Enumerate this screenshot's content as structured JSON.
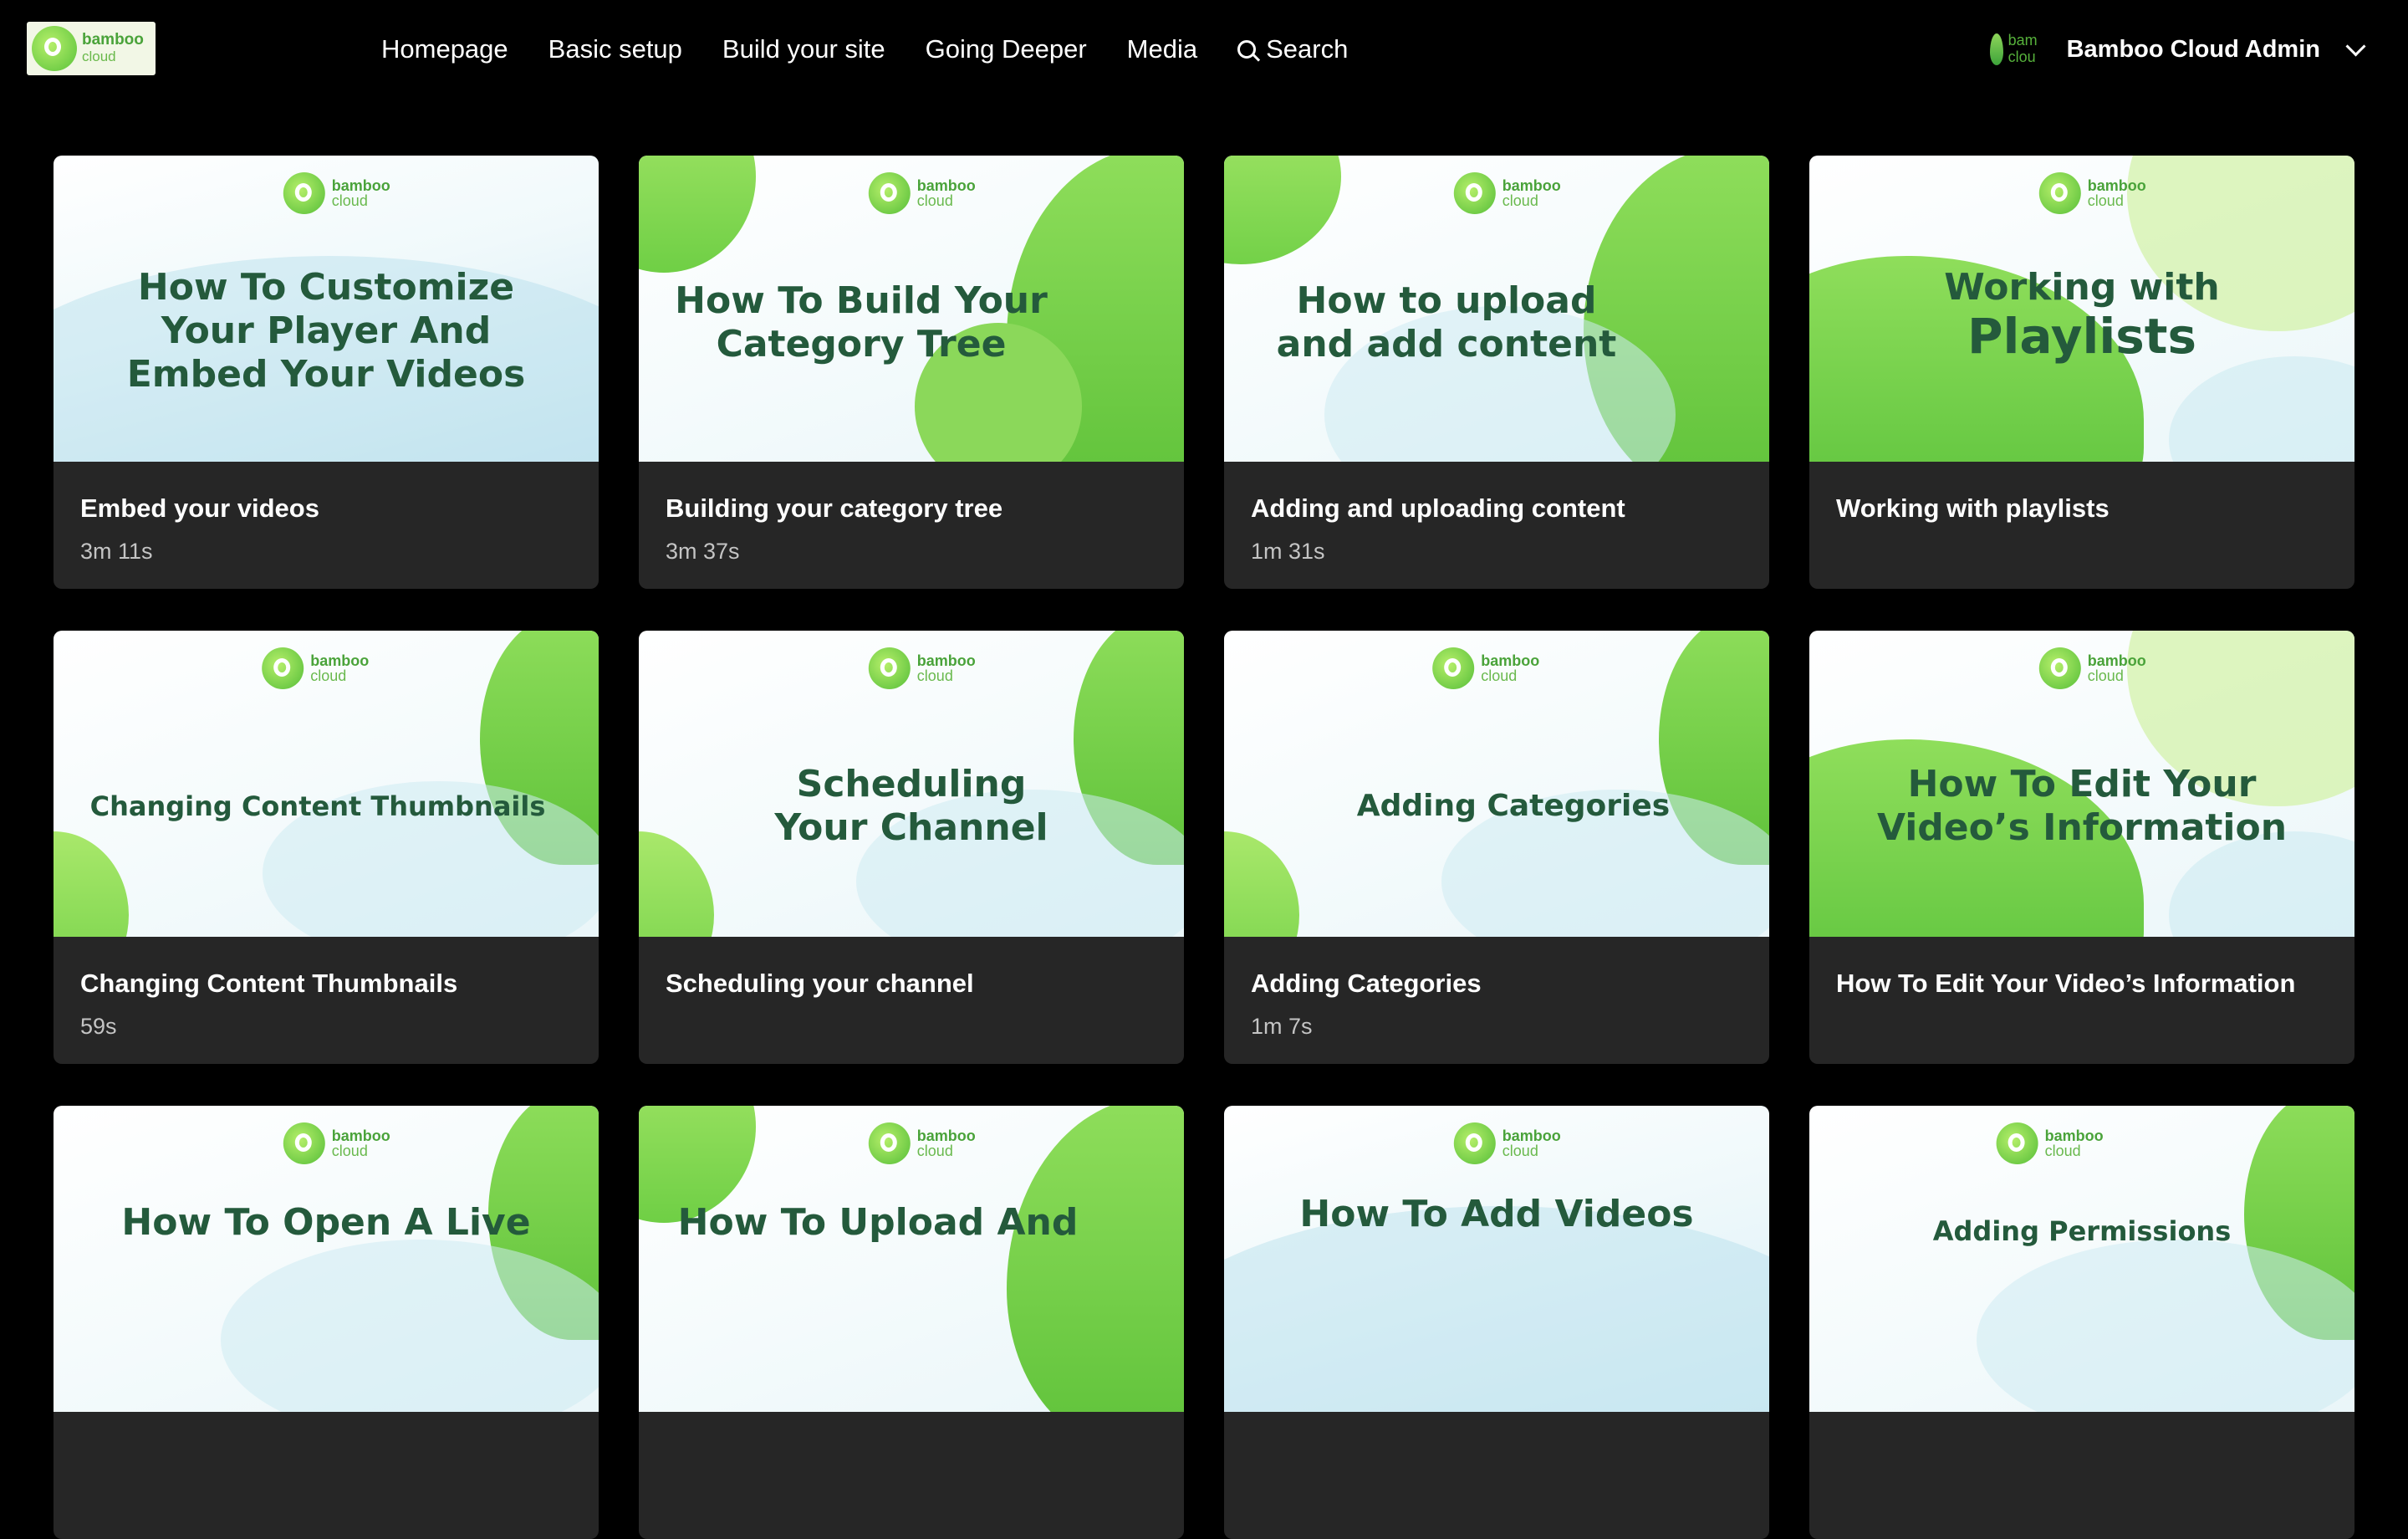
{
  "header": {
    "logo": {
      "word": "bamboo",
      "sub": "cloud"
    },
    "nav": [
      "Homepage",
      "Basic setup",
      "Build your site",
      "Going Deeper",
      "Media"
    ],
    "search_label": "Search",
    "user": {
      "avatar_text": "bam\nclou",
      "name": "Bamboo Cloud Admin"
    }
  },
  "cards": [
    {
      "thumb_title": "How To Customize Your Player And Embed Your Videos",
      "title": "Embed your videos",
      "duration": "3m 11s"
    },
    {
      "thumb_title": "How To Build Your Category Tree",
      "title": "Building your category tree",
      "duration": "3m 37s"
    },
    {
      "thumb_title": "How to upload and add content",
      "title": "Adding and uploading content",
      "duration": "1m 31s"
    },
    {
      "thumb_title_a": "Working with",
      "thumb_title_b": "Playlists",
      "title": "Working with playlists",
      "duration": ""
    },
    {
      "thumb_title": "Changing Content Thumbnails",
      "title": "Changing Content Thumbnails",
      "duration": "59s"
    },
    {
      "thumb_title": "Scheduling Your Channel",
      "title": "Scheduling your channel",
      "duration": ""
    },
    {
      "thumb_title": "Adding Categories",
      "title": "Adding Categories",
      "duration": "1m 7s"
    },
    {
      "thumb_title": "How To Edit Your Video’s Information",
      "title": "How To Edit Your Video’s Information",
      "duration": ""
    },
    {
      "thumb_title": "How To Open A Live",
      "title": "",
      "duration": ""
    },
    {
      "thumb_title": "How To Upload And",
      "title": "",
      "duration": ""
    },
    {
      "thumb_title": "How To Add Videos",
      "title": "",
      "duration": ""
    },
    {
      "thumb_title": "Adding Permissions",
      "title": "",
      "duration": ""
    }
  ],
  "brand_word": "bamboo",
  "brand_sub": "cloud",
  "colors": {
    "accent": "#7ed957",
    "background": "#000000",
    "card": "#262626",
    "thumb_text": "#245a3c"
  }
}
